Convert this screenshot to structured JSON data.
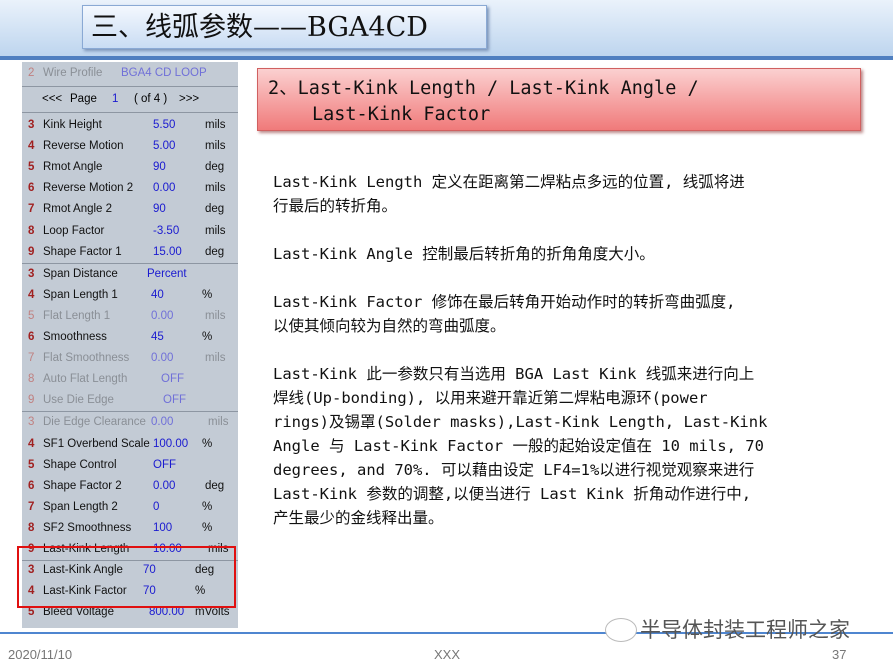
{
  "title": "三、线弧参数——BGA4CD",
  "panel": {
    "wire_profile": {
      "num": "2",
      "label": "Wire Profile",
      "value": "BGA4 CD LOOP"
    },
    "page": {
      "prev": "<<<",
      "label": "Page",
      "current": "1",
      "of": "( of 4 )",
      "next": ">>>"
    },
    "rows": [
      {
        "num": "3",
        "label": "Kink Height",
        "value": "5.50",
        "unit": "mils"
      },
      {
        "num": "4",
        "label": "Reverse Motion",
        "value": "5.00",
        "unit": "mils"
      },
      {
        "num": "5",
        "label": "Rmot Angle",
        "value": "90",
        "unit": "deg"
      },
      {
        "num": "6",
        "label": "Reverse Motion 2",
        "value": "0.00",
        "unit": "mils"
      },
      {
        "num": "7",
        "label": "Rmot Angle 2",
        "value": "90",
        "unit": "deg"
      },
      {
        "num": "8",
        "label": "Loop Factor",
        "value": "-3.50",
        "unit": "mils"
      },
      {
        "num": "9",
        "label": "Shape Factor 1",
        "value": "15.00",
        "unit": "deg"
      },
      {
        "num": "3",
        "label": "Span Distance",
        "value": "Percent",
        "unit": ""
      },
      {
        "num": "4",
        "label": "Span Length 1",
        "value": "40",
        "unit": "%"
      },
      {
        "num": "5",
        "label": "Flat Length 1",
        "value": "0.00",
        "unit": "mils"
      },
      {
        "num": "6",
        "label": "Smoothness",
        "value": "45",
        "unit": "%"
      },
      {
        "num": "7",
        "label": "Flat Smoothness",
        "value": "0.00",
        "unit": "mils"
      },
      {
        "num": "8",
        "label": "Auto Flat Length",
        "value": "OFF",
        "unit": ""
      },
      {
        "num": "9",
        "label": "Use Die Edge",
        "value": "OFF",
        "unit": ""
      },
      {
        "num": "3",
        "label": "Die Edge Clearance",
        "value": "0.00",
        "unit": "mils"
      },
      {
        "num": "4",
        "label": "SF1 Overbend Scale",
        "value": "100.00",
        "unit": "%"
      },
      {
        "num": "5",
        "label": "Shape Control",
        "value": "OFF",
        "unit": ""
      },
      {
        "num": "6",
        "label": "Shape Factor 2",
        "value": "0.00",
        "unit": "deg"
      },
      {
        "num": "7",
        "label": "Span Length 2",
        "value": "0",
        "unit": "%"
      },
      {
        "num": "8",
        "label": "SF2 Smoothness",
        "value": "100",
        "unit": "%"
      },
      {
        "num": "9",
        "label": "Last-Kink Length",
        "value": "10.00",
        "unit": "mils"
      },
      {
        "num": "3",
        "label": "Last-Kink Angle",
        "value": "70",
        "unit": "deg"
      },
      {
        "num": "4",
        "label": "Last-Kink Factor",
        "value": "70",
        "unit": "%"
      },
      {
        "num": "5",
        "label": "Bleed Voltage",
        "value": "800.00",
        "unit": "mVolts"
      }
    ]
  },
  "header": {
    "line1": "2、Last-Kink Length / Last-Kink Angle /",
    "line2": "Last-Kink Factor"
  },
  "body": [
    [
      "Last-Kink Length 定义在距离第二焊粘点多远的位置, 线弧将进",
      "行最后的转折角。"
    ],
    [
      "Last-Kink Angle 控制最后转折角的折角角度大小。"
    ],
    [
      "Last-Kink Factor 修饰在最后转角开始动作时的转折弯曲弧度,",
      "以使其倾向较为自然的弯曲弧度。"
    ],
    [
      "Last-Kink 此一参数只有当选用 BGA Last Kink 线弧来进行向上",
      "焊线(Up-bonding), 以用来避开靠近第二焊粘电源环(power",
      "rings)及锡罩(Solder masks),Last-Kink Length, Last-Kink",
      "Angle 与 Last-Kink Factor 一般的起始设定值在 10 mils, 70",
      "degrees, and 70%. 可以藉由设定 LF4=1%以进行视觉观察来进行",
      "Last-Kink 参数的调整,以便当进行 Last Kink 折角动作进行中,",
      "产生最少的金线释出量。"
    ]
  ],
  "footer": {
    "date": "2020/11/10",
    "center": "XXX",
    "page": "37",
    "watermark": "半导体封装工程师之家"
  }
}
